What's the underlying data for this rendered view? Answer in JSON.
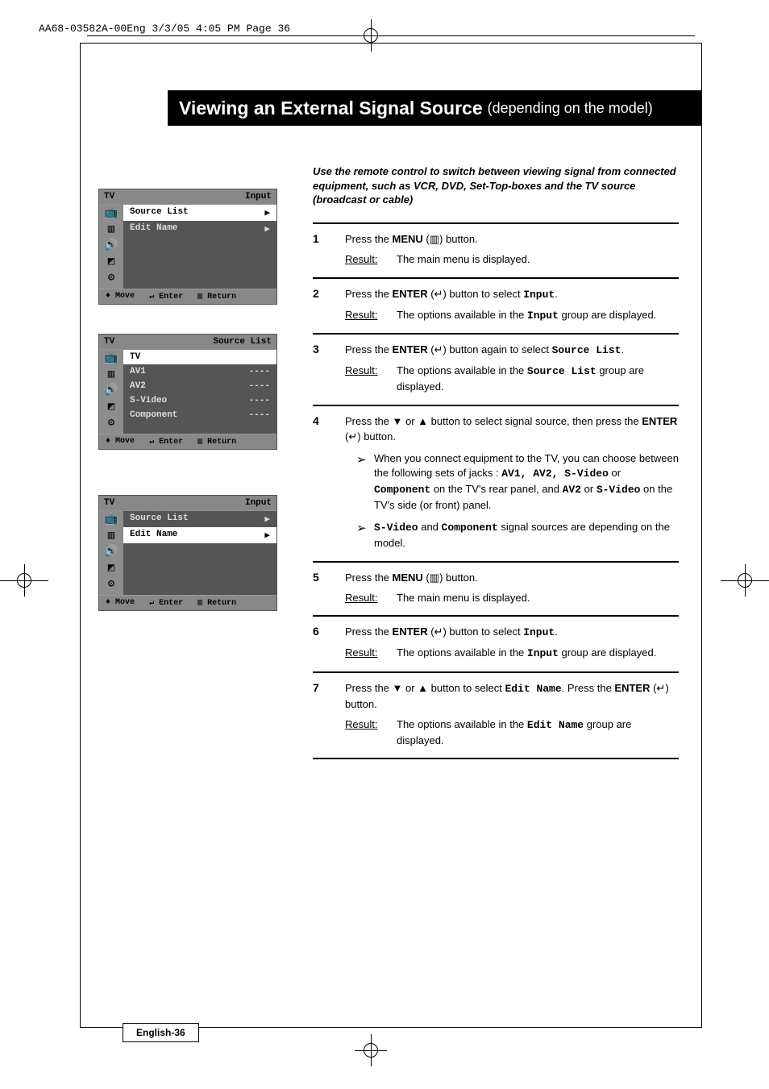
{
  "print_header": "AA68-03582A-00Eng  3/3/05  4:05 PM  Page 36",
  "title_main": "Viewing an External Signal Source",
  "title_sub": "(depending on the model)",
  "intro": "Use the remote control to switch between viewing signal from connected equipment, such as VCR, DVD, Set-Top-boxes and the TV source (broadcast or cable)",
  "osd": {
    "panel1": {
      "hdr_left": "TV",
      "hdr_right": "Input",
      "rows": [
        {
          "label": "Source List",
          "val": "▶",
          "sel": true
        },
        {
          "label": "Edit Name",
          "val": "▶",
          "sel": false
        }
      ],
      "footer": {
        "move": "Move",
        "enter": "Enter",
        "ret": "Return"
      }
    },
    "panel2": {
      "hdr_left": "TV",
      "hdr_right": "Source List",
      "rows": [
        {
          "label": "TV",
          "val": "",
          "sel": true
        },
        {
          "label": "AV1",
          "val": "----",
          "sel": false
        },
        {
          "label": "AV2",
          "val": "----",
          "sel": false
        },
        {
          "label": "S-Video",
          "val": "----",
          "sel": false
        },
        {
          "label": "Component",
          "val": "----",
          "sel": false
        }
      ],
      "footer": {
        "move": "Move",
        "enter": "Enter",
        "ret": "Return"
      }
    },
    "panel3": {
      "hdr_left": "TV",
      "hdr_right": "Input",
      "rows": [
        {
          "label": "Source List",
          "val": "▶",
          "sel": false
        },
        {
          "label": "Edit Name",
          "val": "▶",
          "sel": true
        }
      ],
      "footer": {
        "move": "Move",
        "enter": "Enter",
        "ret": "Return"
      }
    }
  },
  "labels": {
    "result": "Result",
    "menu": "MENU",
    "enter": "ENTER"
  },
  "steps": {
    "s1": {
      "no": "1",
      "line_a": "Press the ",
      "line_b": " (",
      "line_c": ") button.",
      "result": "The main menu is displayed."
    },
    "s2": {
      "no": "2",
      "line_a": "Press the ",
      "line_b": " (",
      "line_c": ") button to select ",
      "code": "Input",
      "line_d": ".",
      "result_a": "The options available in the ",
      "result_code": "Input",
      "result_b": " group are displayed."
    },
    "s3": {
      "no": "3",
      "line_a": "Press the ",
      "line_b": " (",
      "line_c": ") button again to select ",
      "code": "Source List",
      "line_d": ".",
      "result_a": "The options available in the ",
      "result_code": "Source List",
      "result_b": " group are displayed."
    },
    "s4": {
      "no": "4",
      "line": "Press the ▼ or ▲ button to select signal source, then press the ",
      "line_b": " (",
      "line_c": ") button.",
      "sub1_a": "When you connect equipment to the TV, you can choose between the following sets of jacks : ",
      "sub1_codes": "AV1, AV2, S-Video",
      "sub1_b": " or ",
      "sub1_code2": "Component",
      "sub1_c": " on the TV's rear panel, and ",
      "sub1_code3": "AV2",
      "sub1_d": " or ",
      "sub1_code4": "S-Video",
      "sub1_e": " on the TV's side (or front) panel.",
      "sub2_code1": "S-Video",
      "sub2_a": " and ",
      "sub2_code2": "Component",
      "sub2_b": " signal sources are depending on the model."
    },
    "s5": {
      "no": "5",
      "line_a": "Press the ",
      "line_b": " (",
      "line_c": ") button.",
      "result": "The main menu is displayed."
    },
    "s6": {
      "no": "6",
      "line_a": "Press the ",
      "line_b": " (",
      "line_c": ") button to select ",
      "code": "Input",
      "line_d": ".",
      "result_a": "The options available in the ",
      "result_code": "Input",
      "result_b": " group are displayed."
    },
    "s7": {
      "no": "7",
      "line_a": "Press the ▼ or ▲ button to select ",
      "code": "Edit Name",
      "line_b": ". Press the ",
      "line_c": " (",
      "line_d": ") button.",
      "result_a": "The options available in the ",
      "result_code": "Edit Name",
      "result_b": " group are displayed."
    }
  },
  "page_number": "English-36",
  "icons": {
    "menu_glyph": "▥",
    "enter_glyph": "↵",
    "move_glyph": "♦",
    "return_glyph": "▥"
  }
}
